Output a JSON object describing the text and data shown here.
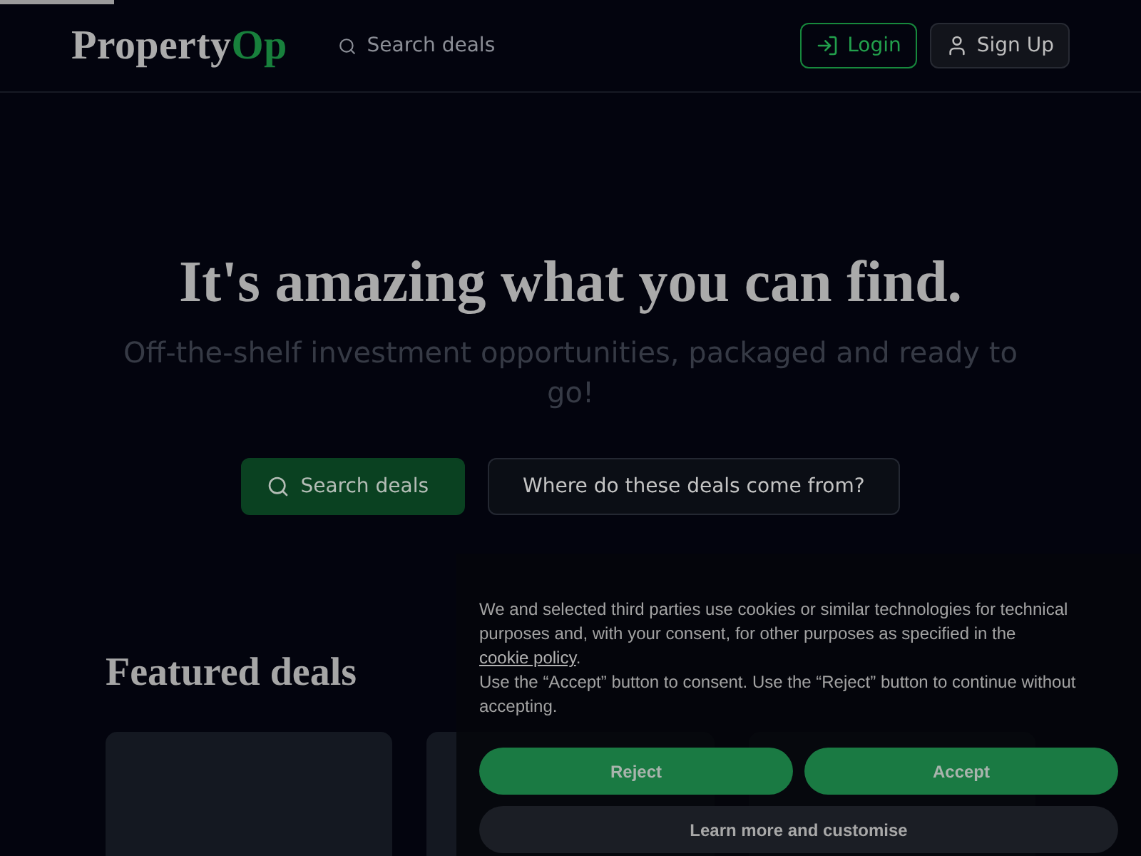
{
  "loading_bar": {
    "level": 0.1
  },
  "header": {
    "logo": {
      "name": "Property",
      "accent": "Op"
    },
    "search": "Search deals",
    "buttons": [
      {
        "kind": "login",
        "label": "Login"
      },
      {
        "kind": "signup",
        "label": "Sign Up"
      }
    ]
  },
  "hero": {
    "title": "It's amazing what you can find.",
    "subtitle": "Off-the-shelf investment opportunities, packaged and ready to go!",
    "buttons": [
      {
        "kind": "primary",
        "label": "Search deals"
      },
      {
        "kind": "secondary",
        "label": "Where do these deals come from?"
      }
    ]
  },
  "featured": {
    "title": "Featured deals"
  },
  "cookie_banner": {
    "notice": {
      "text": "We and selected third parties use cookies or similar technologies for technical purposes and, with your consent, for other purposes as specified in the",
      "link": "cookie policy",
      "end": "."
    },
    "note": "Use the “Accept” button to consent. Use the “Reject” button to continue without accepting.",
    "buttons": [
      {
        "kind": "reject",
        "label": "Reject"
      },
      {
        "kind": "accept",
        "label": "Accept"
      },
      {
        "kind": "more",
        "label": "Learn more and customise"
      }
    ]
  }
}
